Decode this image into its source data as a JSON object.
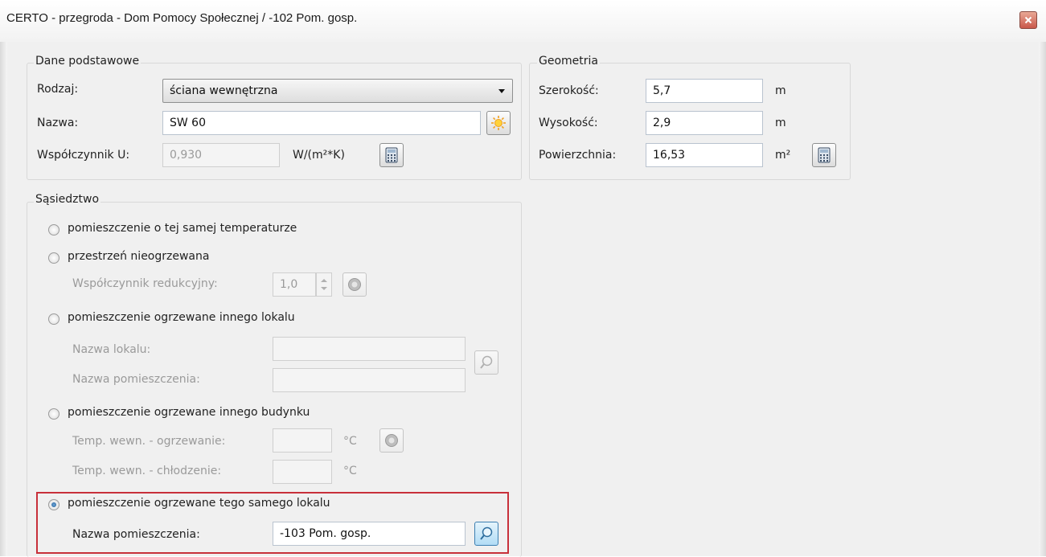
{
  "window": {
    "title": "CERTO - przegroda - Dom Pomocy Społecznej / -102 Pom. gosp."
  },
  "colors": {
    "highlight": "#c8303a",
    "accent_blue": "#3c7fb1"
  },
  "basic": {
    "group_title": "Dane podstawowe",
    "type_label": "Rodzaj:",
    "type_value": "ściana wewnętrzna",
    "name_label": "Nazwa:",
    "name_value": "SW 60",
    "u_label": "Współczynnik U:",
    "u_value": "0,930",
    "u_unit": "W/(m²*K)"
  },
  "geometry": {
    "group_title": "Geometria",
    "width_label": "Szerokość:",
    "width_value": "5,7",
    "width_unit": "m",
    "height_label": "Wysokość:",
    "height_value": "2,9",
    "height_unit": "m",
    "area_label": "Powierzchnia:",
    "area_value": "16,53",
    "area_unit": "m²"
  },
  "neighborhood": {
    "group_title": "Sąsiedztwo",
    "opt_same_temp": "pomieszczenie o tej samej temperaturze",
    "opt_unheated": "przestrzeń nieogrzewana",
    "reduction_label": "Współczynnik redukcyjny:",
    "reduction_value": "1,0",
    "opt_other_unit": "pomieszczenie ogrzewane innego lokalu",
    "unit_name_label": "Nazwa lokalu:",
    "unit_name_value": "",
    "room_name_label": "Nazwa pomieszczenia:",
    "room_name_value": "",
    "opt_other_building": "pomieszczenie ogrzewane innego budynku",
    "temp_heating_label": "Temp. wewn. - ogrzewanie:",
    "temp_heating_value": "",
    "temp_heating_unit": "°C",
    "temp_cooling_label": "Temp. wewn. - chłodzenie:",
    "temp_cooling_value": "",
    "temp_cooling_unit": "°C",
    "opt_same_unit": "pomieszczenie ogrzewane tego samego lokalu",
    "same_unit_room_label": "Nazwa pomieszczenia:",
    "same_unit_room_value": "-103 Pom. gosp.",
    "selected_option": "pomieszczenie ogrzewane tego samego lokalu"
  }
}
